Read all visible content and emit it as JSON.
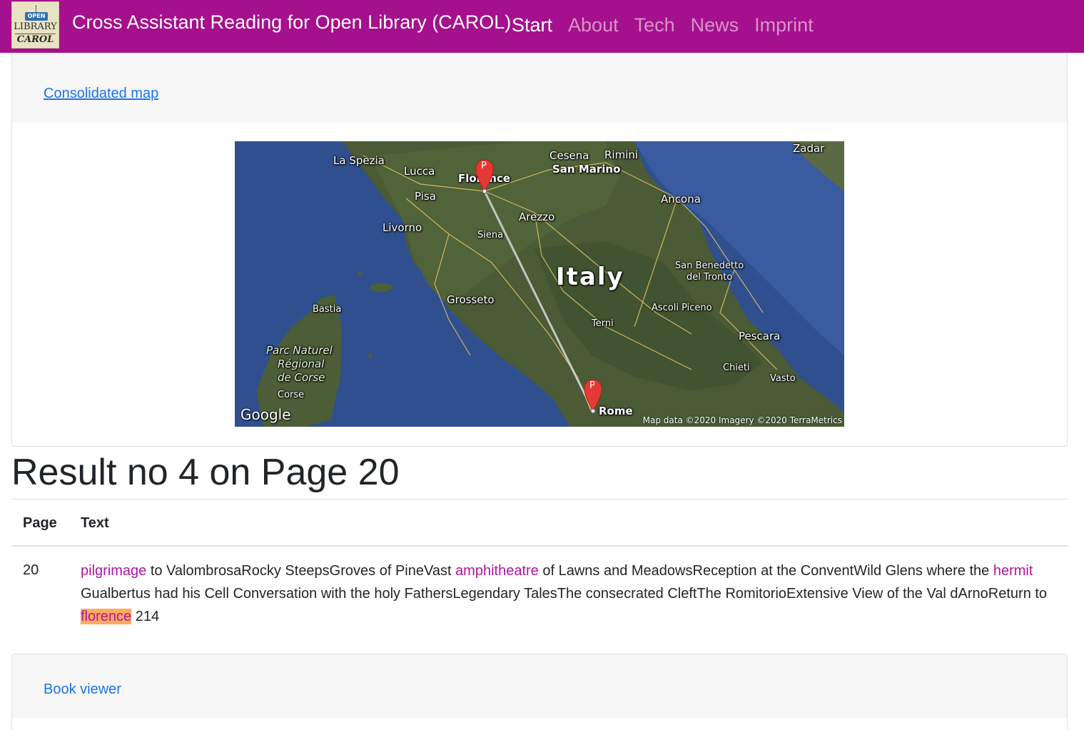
{
  "navbar": {
    "logo": {
      "tag": "OPEN",
      "line1": "LIBRARY",
      "line2": "CAROL"
    },
    "title": "Cross Assistant Reading for Open Library (CAROL)",
    "links": [
      "Start",
      "About",
      "Tech",
      "News",
      "Imprint"
    ],
    "active": "Start",
    "color": "#a5108c"
  },
  "map_card": {
    "link": "Consolidated map",
    "map": {
      "labels": {
        "la_spezia": "La Spezia",
        "lucca": "Lucca",
        "florence": "Florence",
        "pisa": "Pisa",
        "livorno": "Livorno",
        "siena": "Siena",
        "arezzo": "Arezzo",
        "cesena": "Cesena",
        "rimini": "Rimini",
        "san_marino": "San Marino",
        "zadar": "Zadar",
        "ancona": "Ancona",
        "italy": "Italy",
        "san_benedetto_1": "San Benedetto",
        "san_benedetto_2": "del Tronto",
        "ascoli": "Ascoli Piceno",
        "grosseto": "Grosseto",
        "bastia": "Bastia",
        "terni": "Terni",
        "pescara": "Pescara",
        "chieti": "Chieti",
        "vasto": "Vasto",
        "parc_1": "Parc Naturel",
        "parc_2": "Régional",
        "parc_3": "de Corse",
        "corse": "Corse",
        "rome": "Rome"
      },
      "marker_letter": "P",
      "google": "Google",
      "attribution": "Map data ©2020  Imagery ©2020 TerraMetrics"
    }
  },
  "result": {
    "heading": "Result no 4 on Page 20",
    "columns": [
      "Page",
      "Text"
    ],
    "row": {
      "page": "20",
      "segments": [
        {
          "text": "pilgrimage",
          "kw": true
        },
        {
          "text": " to ValombrosaRocky SteepsGroves of PineVast "
        },
        {
          "text": "amphitheatre",
          "kw": true
        },
        {
          "text": " of Lawns and MeadowsReception at the ConventWild Glens where the "
        },
        {
          "text": "hermit",
          "kw": true
        },
        {
          "text": " Gualbertus had his Cell Conversation with the holy FathersLegendary TalesThe consecrated CleftThe RomitorioExtensive View of the Val dArnoReturn to "
        },
        {
          "text": "florence",
          "kw": true,
          "highlight": true
        },
        {
          "text": " 214"
        }
      ]
    },
    "keyword_color": "#b014a0",
    "highlight_color": "#fdab5f"
  },
  "viewer_card": {
    "link": "Book viewer"
  }
}
